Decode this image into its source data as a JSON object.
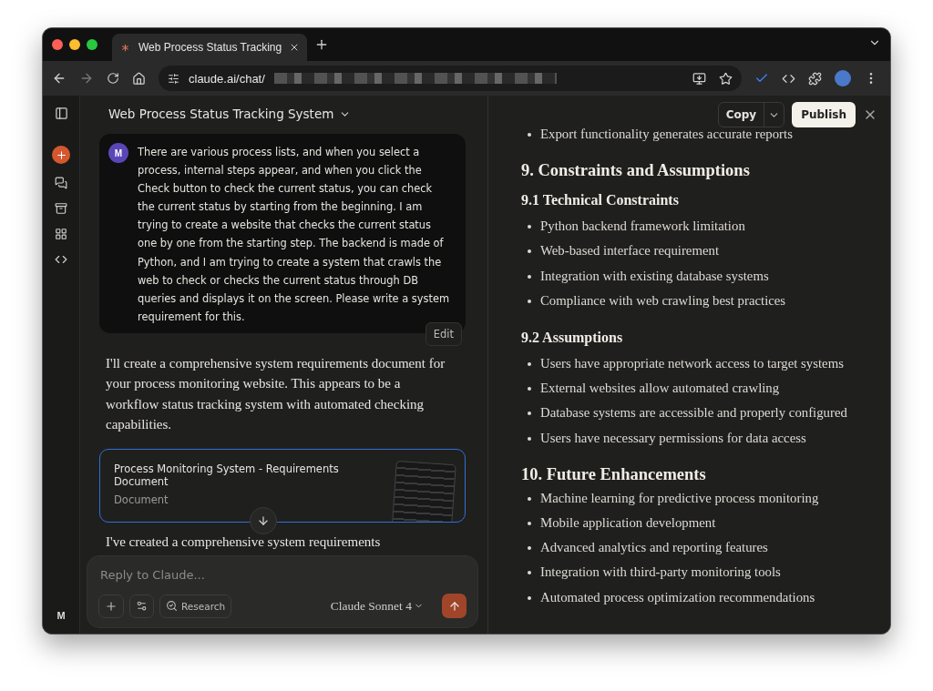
{
  "browser": {
    "tabs": [
      {
        "title": "Web Process Status Tracking",
        "selected": true
      }
    ],
    "address": "claude.ai/chat/"
  },
  "rail": {
    "avatar": "M"
  },
  "chat": {
    "title": "Web Process Status Tracking System",
    "user_message": {
      "avatar": "M",
      "text": "There are various process lists, and when you select a process, internal steps appear, and when you click the Check button to check the current status, you can check the current status by starting from the beginning. I am trying to create a website that checks the current status one by one from the starting step. The backend is made of Python, and I am trying to create a system that crawls the web to check or checks the current status through DB queries and displays it on the screen. Please write a system requirement for this.",
      "edit": "Edit"
    },
    "assistant_text": "I'll create a comprehensive system requirements document for your process monitoring website. This appears to be a workflow status tracking system with automated checking capabilities.",
    "artifact": {
      "title": "Process Monitoring System - Requirements Document",
      "type": "Document"
    },
    "trailing_text": "I've created a comprehensive system requirements"
  },
  "composer": {
    "placeholder": "Reply to Claude...",
    "research": "Research",
    "model": "Claude Sonnet 4"
  },
  "document": {
    "copy": "Copy",
    "publish": "Publish",
    "blocks": [
      {
        "kind": "bullet",
        "text": "Export functionality generates accurate reports"
      },
      {
        "kind": "h2",
        "text": "9. Constraints and Assumptions"
      },
      {
        "kind": "h3",
        "text": "9.1 Technical Constraints"
      },
      {
        "kind": "bullet",
        "text": "Python backend framework limitation"
      },
      {
        "kind": "bullet",
        "text": "Web-based interface requirement"
      },
      {
        "kind": "bullet",
        "text": "Integration with existing database systems"
      },
      {
        "kind": "bullet",
        "text": "Compliance with web crawling best practices"
      },
      {
        "kind": "h3",
        "text": "9.2 Assumptions"
      },
      {
        "kind": "bullet",
        "text": "Users have appropriate network access to target systems"
      },
      {
        "kind": "bullet",
        "text": "External websites allow automated crawling"
      },
      {
        "kind": "bullet",
        "text": "Database systems are accessible and properly configured"
      },
      {
        "kind": "bullet",
        "text": "Users have necessary permissions for data access"
      },
      {
        "kind": "h2",
        "text": "10. Future Enhancements"
      },
      {
        "kind": "bullet",
        "text": "Machine learning for predictive process monitoring"
      },
      {
        "kind": "bullet",
        "text": "Mobile application development"
      },
      {
        "kind": "bullet",
        "text": "Advanced analytics and reporting features"
      },
      {
        "kind": "bullet",
        "text": "Integration with third-party monitoring tools"
      },
      {
        "kind": "bullet",
        "text": "Automated process optimization recommendations"
      }
    ]
  }
}
